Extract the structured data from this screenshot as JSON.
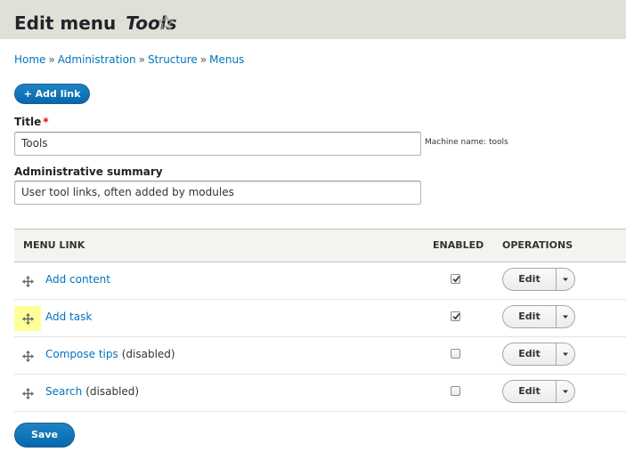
{
  "header": {
    "title_prefix": "Edit menu",
    "title_menu": "Tools",
    "shortcut_icon": "star-icon"
  },
  "breadcrumb": {
    "items": [
      "Home",
      "Administration",
      "Structure",
      "Menus"
    ],
    "separator": "»"
  },
  "actions": {
    "add_link_label": "+ Add link"
  },
  "form": {
    "title_label": "Title",
    "required_mark": "*",
    "title_value": "Tools",
    "machine_name_label": "Machine name: tools",
    "summary_label": "Administrative summary",
    "summary_value": "User tool links, often added by modules"
  },
  "table": {
    "headers": {
      "menu_link": "MENU LINK",
      "enabled": "ENABLED",
      "operations": "OPERATIONS"
    },
    "rows": [
      {
        "link": "Add content",
        "status": "",
        "enabled": true,
        "operation": "Edit"
      },
      {
        "link": "Add task",
        "status": "",
        "enabled": true,
        "operation": "Edit"
      },
      {
        "link": "Compose tips",
        "status": "(disabled)",
        "enabled": false,
        "operation": "Edit"
      },
      {
        "link": "Search",
        "status": "(disabled)",
        "enabled": false,
        "operation": "Edit"
      }
    ]
  },
  "footer": {
    "save_label": "Save"
  },
  "colors": {
    "link": "#0074bd",
    "primary_button": "#0668ae",
    "header_bg": "#e0e0d8",
    "drag_highlight": "#ffff99"
  }
}
